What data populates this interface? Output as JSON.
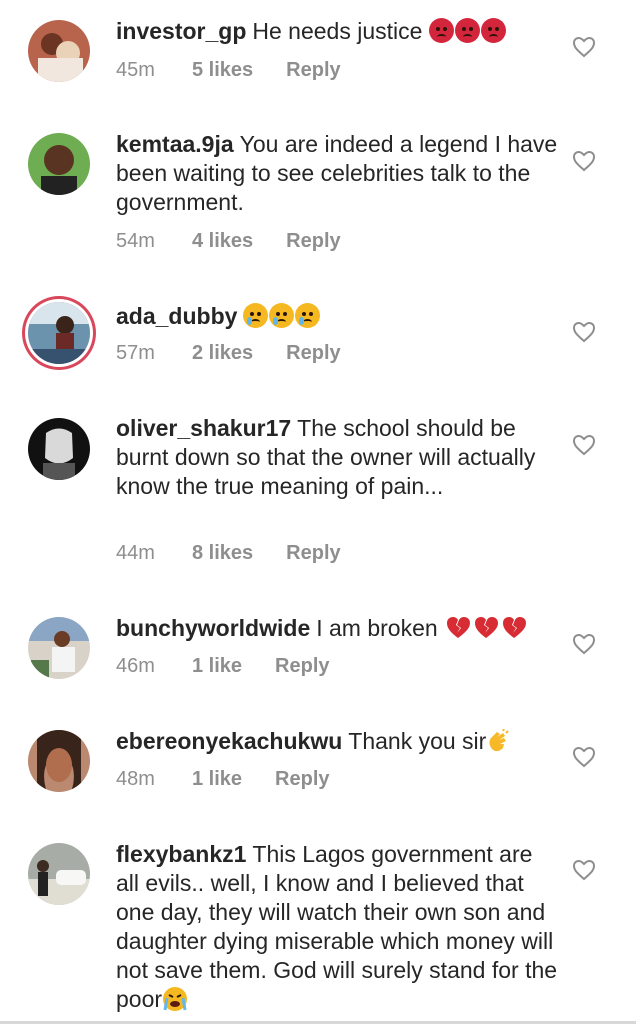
{
  "comments": [
    {
      "username": "investor_gp",
      "text": "He needs justice",
      "time": "45m",
      "likes": "5 likes",
      "reply": "Reply",
      "emoji": "angry-face x3"
    },
    {
      "username": "kemtaa.9ja",
      "text": "You are indeed a legend I have been waiting to see celebrities talk to the government.",
      "time": "54m",
      "likes": "4 likes",
      "reply": "Reply"
    },
    {
      "username": "ada_dubby",
      "text": "",
      "time": "57m",
      "likes": "2 likes",
      "reply": "Reply",
      "emoji": "crying-face x3"
    },
    {
      "username": "oliver_shakur17",
      "text": "The school should be burnt down so that the owner will actually know the true meaning of pain...",
      "time": "44m",
      "likes": "8 likes",
      "reply": "Reply"
    },
    {
      "username": "bunchyworldwide",
      "text": "I am broken",
      "time": "46m",
      "likes": "1 like",
      "reply": "Reply",
      "emoji": "broken-heart x3"
    },
    {
      "username": "ebereonyekachukwu",
      "text": "Thank you sir",
      "time": "48m",
      "likes": "1 like",
      "reply": "Reply",
      "emoji": "clapping-hands"
    },
    {
      "username": "flexybankz1",
      "text": "This Lagos government are all evils.. well, I know and I believed that one day, they will watch their own son and daughter dying miserable which money will not save them. God will surely stand for the poor",
      "time": "",
      "likes": "",
      "reply": "",
      "emoji": "loudly-crying-face"
    }
  ],
  "colors": {
    "text": "#262626",
    "meta": "#8e8e8e",
    "background": "#ffffff"
  }
}
